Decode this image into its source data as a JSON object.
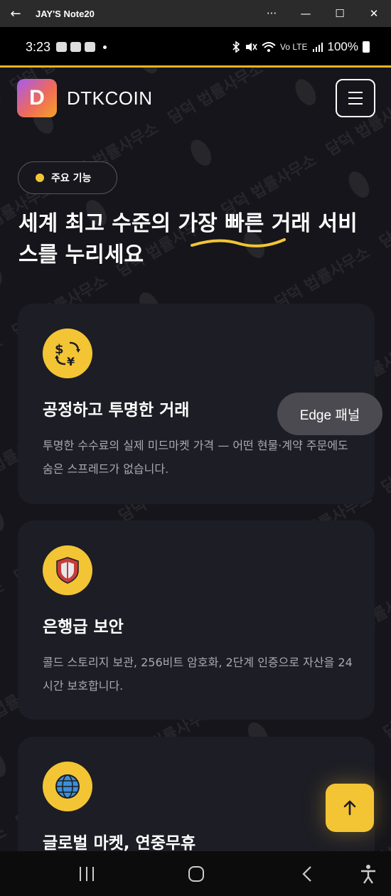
{
  "window": {
    "title": "JAY'S Note20",
    "back_glyph": "←",
    "more_glyph": "···",
    "minimize_glyph": "—",
    "maximize_glyph": "☐",
    "close_glyph": "✕"
  },
  "status_bar": {
    "time": "3:23",
    "battery": "100%",
    "signal_label": "Vo LTE"
  },
  "app": {
    "logo_letter": "D",
    "brand": "DTKCOIN",
    "feature_label": "주요 기능",
    "headline": "세계 최고 수준의 가장 빠른 거래 서비스를 누리세요",
    "cards": [
      {
        "icon": "currency-exchange-icon",
        "title": "공정하고 투명한 거래",
        "desc": "투명한 수수료의 실제 미드마켓 가격 — 어떤 현물·계약 주문에도 숨은 스프레드가 없습니다."
      },
      {
        "icon": "shield-icon",
        "title": "은행급 보안",
        "desc": "콜드 스토리지 보관, 256비트 암호화, 2단계 인증으로 자산을 24시간 보호합니다."
      },
      {
        "icon": "globe-icon",
        "title": "글로벌 마켓, 연중무휴",
        "desc": ""
      }
    ],
    "edge_panel_label": "Edge 패널",
    "scroll_top_glyph": "↑"
  },
  "watermark_text": "담덕 법률사무소",
  "colors": {
    "accent": "#f3c534",
    "background": "#15151b",
    "card": "#1d1d25",
    "muted_text": "#a9a9b2"
  }
}
